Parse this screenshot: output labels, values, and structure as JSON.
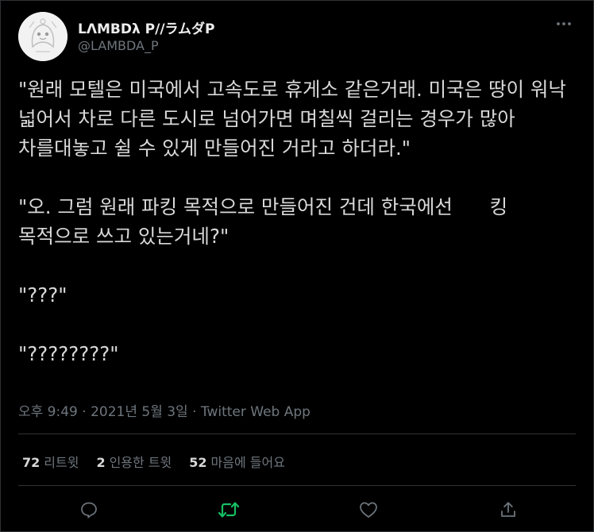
{
  "author": {
    "display_name": "LΛMBDλ P//ラムダP",
    "handle": "@LAMBDA_P"
  },
  "tweet": {
    "paragraphs": [
      "\"원래 모텔은 미국에서 고속도로 휴게소 같은거래. 미국은 땅이 워낙 넓어서 차로 다른 도시로 넘어가면 며칠씩 걸리는 경우가 많아 차를대놓고 쉴 수 있게 만들어진 거라고 하더라.\"",
      "\"오. 그럼 원래 파킹 목적으로 만들어진 건데 한국에선      킹 목적으로 쓰고 있는거네?\"",
      "\"???\"",
      "\"????????\""
    ]
  },
  "meta": {
    "timestamp": "오후 9:49 · 2021년 5월 3일 · ",
    "source_app": "Twitter Web App"
  },
  "stats": {
    "retweets_count": "72",
    "retweets_label": "리트윗",
    "quotes_count": "2",
    "quotes_label": "인용한 트윗",
    "likes_count": "52",
    "likes_label": "마음에 들어요"
  },
  "icons": {
    "more": "more-icon",
    "reply": "reply-icon",
    "retweet": "retweet-icon",
    "like": "like-icon",
    "share": "share-icon"
  },
  "colors": {
    "background": "#000000",
    "text": "#d9d9d9",
    "secondary_text": "#6e767d",
    "retweet_active": "#17bf63",
    "divider": "#2f3336"
  }
}
